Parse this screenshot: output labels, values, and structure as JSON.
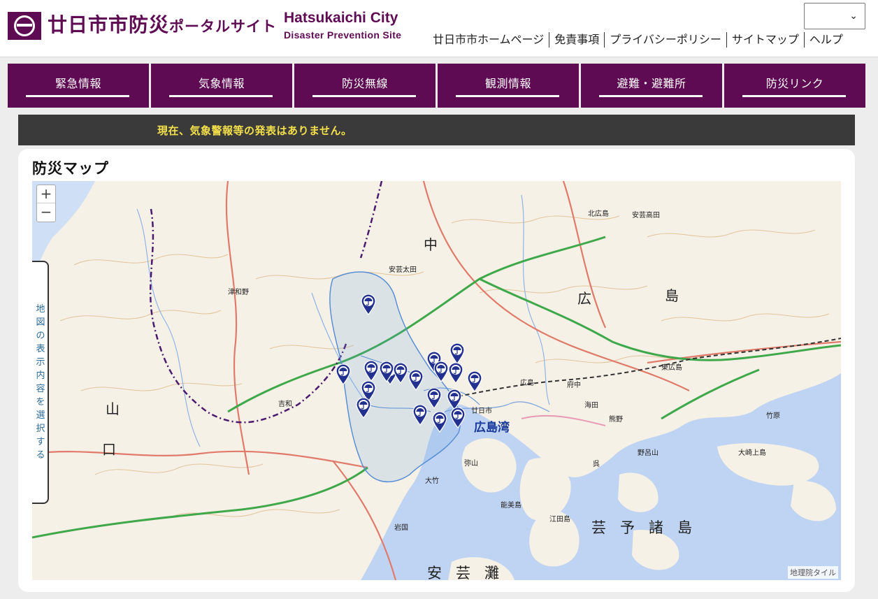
{
  "header": {
    "title_main": "廿日市市防災",
    "title_sub": "ポータルサイト",
    "title_en": "Hatsukaichi City",
    "subtitle_en": "Disaster Prevention Site",
    "language_select_value": "",
    "util_links": [
      "廿日市市ホームページ",
      "免責事項",
      "プライバシーポリシー",
      "サイトマップ",
      "ヘルプ"
    ]
  },
  "nav": {
    "items": [
      "緊急情報",
      "気象情報",
      "防災無線",
      "観測情報",
      "避難・避難所",
      "防災リンク"
    ]
  },
  "alert": {
    "message": "現在、気象警報等の発表はありません。"
  },
  "map_panel": {
    "title": "防災マップ",
    "zoom_in_label": "+",
    "zoom_out_label": "−",
    "layer_tab_label": "地図の表示内容を選択する",
    "attribution": "地理院タイル",
    "pin_icon": "umbrella-marker-icon",
    "pin_color": "#22308f",
    "labels": {
      "pref_chugoku": "中",
      "pref_hiroshima1": "広",
      "pref_hiroshima2": "島",
      "yamaguchi": "山",
      "yamaguchi2": "口",
      "bay": "広島湾",
      "sea": "芸予諸島",
      "sea2": "安芸灘",
      "hatsukaichi": "廿日市",
      "hiroshima_city": "広島",
      "fuchu": "府中",
      "kaita": "海田",
      "kumano": "熊野",
      "kure": "呉",
      "otake": "大竹",
      "iwakuni": "岩国",
      "etajima": "江田島",
      "higashihiroshima": "東広島",
      "kitahiroshima": "北広島",
      "akitakata": "安芸高田",
      "akiota": "安芸太田",
      "tsuwano": "津和野",
      "yoshiwa": "吉和",
      "miyajima": "弥山",
      "osakikami": "大崎上島",
      "takehara": "竹原",
      "nomiyama": "野呂山",
      "nomishima": "能美島"
    }
  },
  "colors": {
    "brand": "#5e0b54",
    "alert_bg": "#3a3a3a",
    "alert_text": "#f4e04a",
    "sea": "#bfd3f2",
    "land": "#f6f1e6"
  }
}
